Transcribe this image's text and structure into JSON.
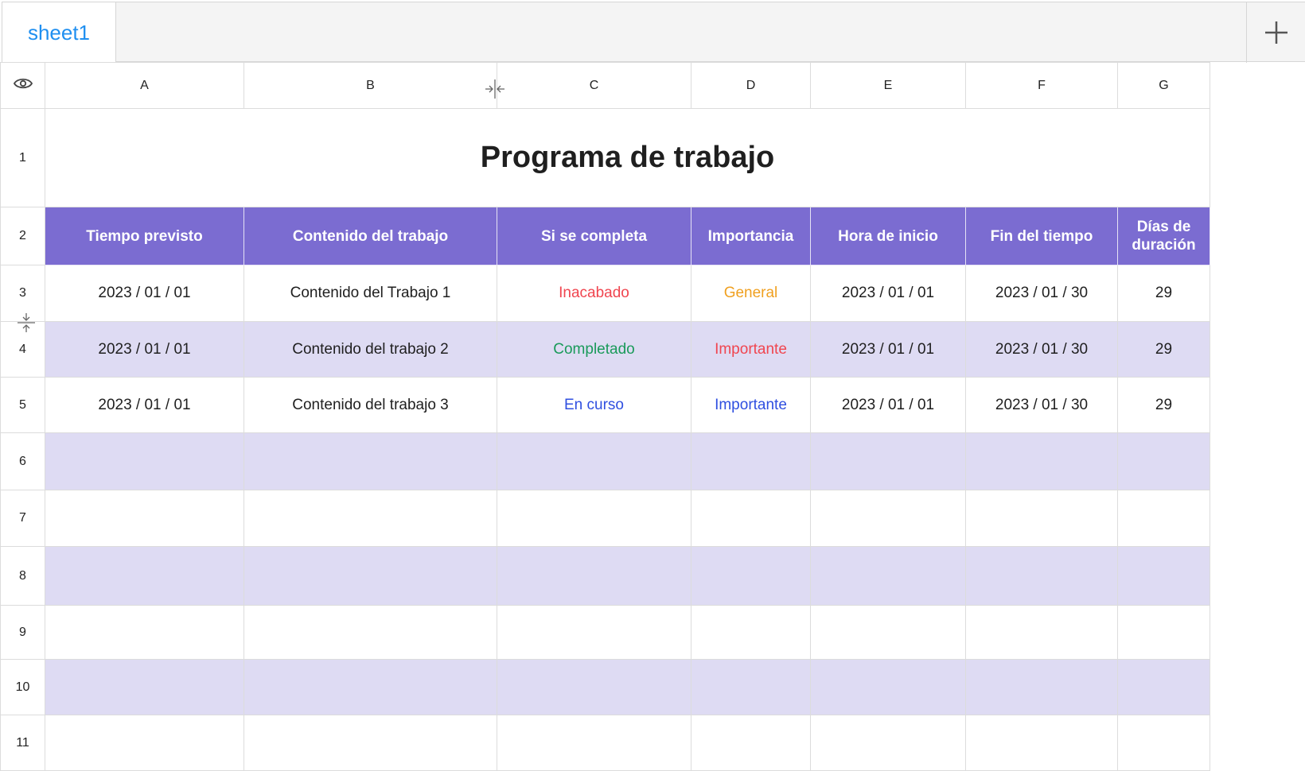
{
  "tabs": [
    {
      "label": "sheet1"
    }
  ],
  "columns": [
    "A",
    "B",
    "C",
    "D",
    "E",
    "F",
    "G"
  ],
  "title": "Programa de trabajo",
  "headers": [
    "Tiempo previsto",
    "Contenido del trabajo",
    "Si se completa",
    "Importancia",
    "Hora de inicio",
    "Fin del tiempo",
    "Días de duración"
  ],
  "rows": [
    [
      "2023 / 01 / 01",
      "Contenido del Trabajo 1",
      "Inacabado",
      "General",
      "2023 / 01 / 01",
      "2023 / 01 / 30",
      "29"
    ],
    [
      "2023 / 01 / 01",
      "Contenido del trabajo 2",
      "Completado",
      "Importante",
      "2023 / 01 / 01",
      "2023 / 01 / 30",
      "29"
    ],
    [
      "2023 / 01 / 01",
      "Contenido del trabajo 3",
      "En curso",
      "Importante",
      "2023 / 01 / 01",
      "2023 / 01 / 30",
      "29"
    ]
  ],
  "status_colors": [
    {
      "status": "#f0454f",
      "importance": "#f0a020"
    },
    {
      "status": "#1a9a5a",
      "importance": "#f0454f"
    },
    {
      "status": "#2f4fe0",
      "importance": "#2f4fe0"
    }
  ],
  "row_numbers": [
    "1",
    "2",
    "3",
    "4",
    "5",
    "6",
    "7",
    "8",
    "9",
    "10",
    "11"
  ],
  "colors": {
    "header_bg": "#7b6cd1",
    "alt_row_bg": "#dedbf3",
    "tab_active": "#1f8ff0"
  },
  "icons": [
    "eye-icon",
    "plus-icon",
    "column-resize-icon",
    "row-resize-icon"
  ]
}
